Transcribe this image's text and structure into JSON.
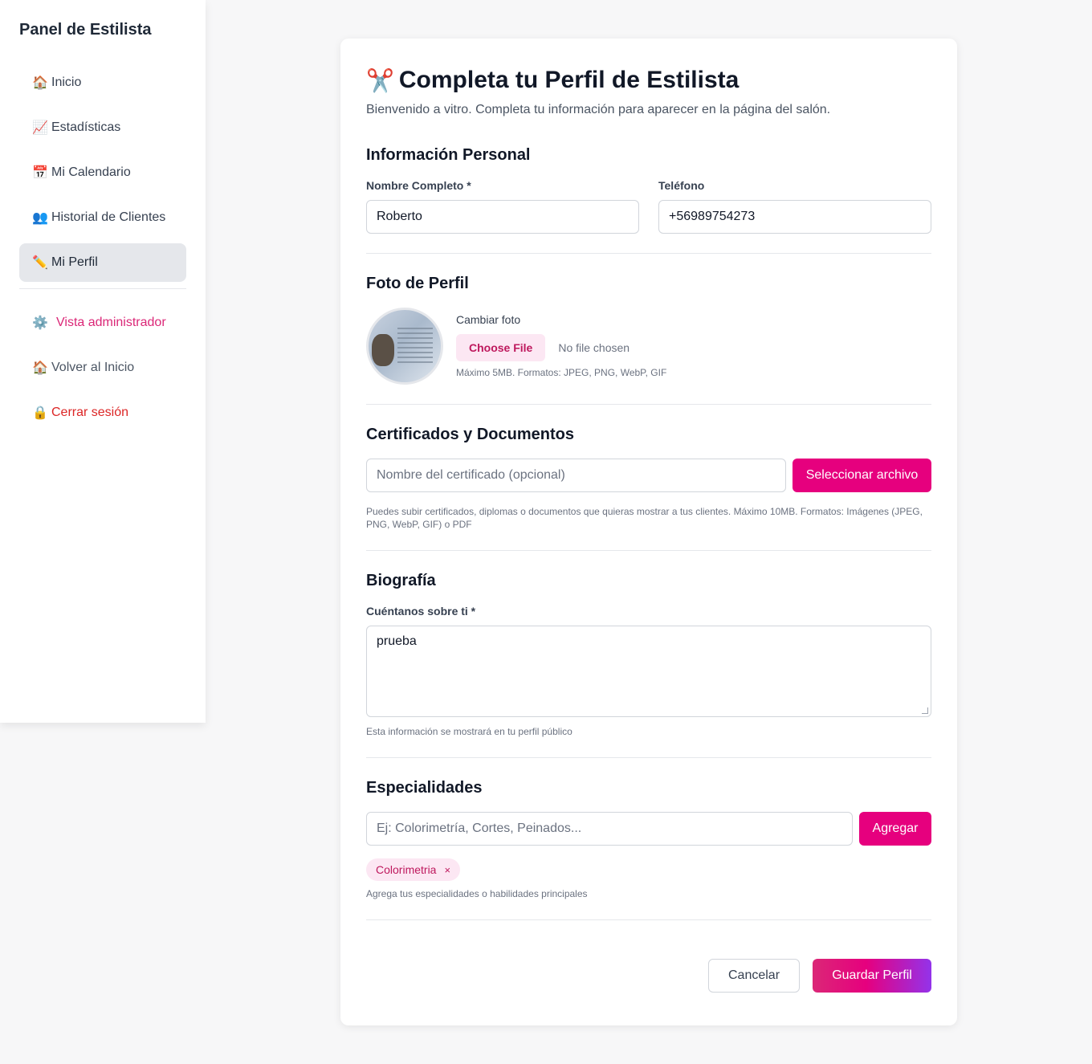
{
  "sidebar": {
    "title": "Panel de Estilista",
    "items": [
      {
        "icon": "🏠",
        "icon_name": "home-icon",
        "label": "Inicio"
      },
      {
        "icon": "📈",
        "icon_name": "chart-icon",
        "label": "Estadísticas"
      },
      {
        "icon": "📅",
        "icon_name": "calendar-icon",
        "label": "Mi Calendario"
      },
      {
        "icon": "👥",
        "icon_name": "users-icon",
        "label": "Historial de Clientes"
      },
      {
        "icon": "✏️",
        "icon_name": "pencil-icon",
        "label": "Mi Perfil",
        "active": true
      }
    ],
    "admin": {
      "icon": "⚙️",
      "label": "Vista administrador"
    },
    "back": {
      "icon": "🏠",
      "label": "Volver al Inicio"
    },
    "logout": {
      "icon": "🔒",
      "label": "Cerrar sesión"
    }
  },
  "header": {
    "icon": "✂️",
    "title": "Completa tu Perfil de Estilista",
    "subtitle": "Bienvenido a vitro. Completa tu información para aparecer en la página del salón."
  },
  "personal": {
    "title": "Información Personal",
    "name_label": "Nombre Completo *",
    "name_value": "Roberto",
    "phone_label": "Teléfono",
    "phone_value": "+56989754273"
  },
  "photo": {
    "title": "Foto de Perfil",
    "change_label": "Cambiar foto",
    "choose_button": "Choose File",
    "no_file": "No file chosen",
    "hint": "Máximo 5MB. Formatos: JPEG, PNG, WebP, GIF"
  },
  "certificates": {
    "title": "Certificados y Documentos",
    "placeholder": "Nombre del certificado (opcional)",
    "select_button": "Seleccionar archivo",
    "hint": "Puedes subir certificados, diplomas o documentos que quieras mostrar a tus clientes. Máximo 10MB. Formatos: Imágenes (JPEG, PNG, WebP, GIF) o PDF"
  },
  "bio": {
    "title": "Biografía",
    "label": "Cuéntanos sobre ti *",
    "value": "prueba",
    "hint": "Esta información se mostrará en tu perfil público"
  },
  "specialties": {
    "title": "Especialidades",
    "placeholder": "Ej: Colorimetría, Cortes, Peinados...",
    "add_button": "Agregar",
    "tags": [
      "Colorimetria"
    ],
    "remove_symbol": "×",
    "hint": "Agrega tus especialidades o habilidades principales"
  },
  "actions": {
    "cancel": "Cancelar",
    "save": "Guardar Perfil"
  },
  "colors": {
    "accent": "#e6007e",
    "accent_light": "#fce7f3",
    "danger": "#dc2626",
    "gradient_end": "#9333ea"
  }
}
